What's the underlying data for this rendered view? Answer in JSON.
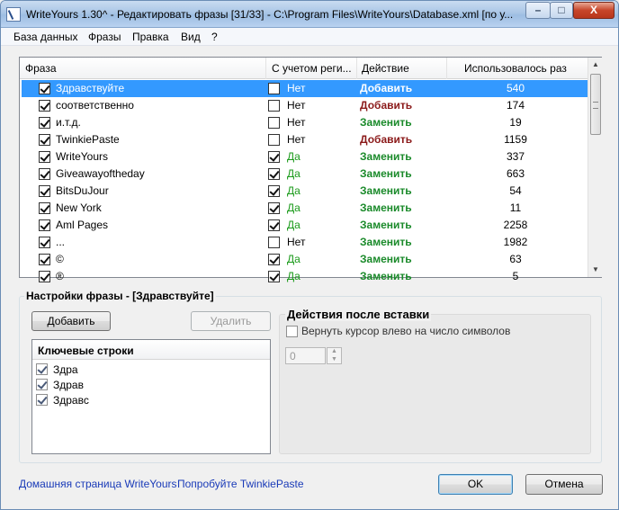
{
  "window": {
    "title": "WriteYours 1.30^ - Редактировать фразы [31/33] - C:\\Program Files\\WriteYours\\Database.xml [по у...",
    "minimize": "–",
    "maximize": "□",
    "close": "X"
  },
  "menu": [
    "База данных",
    "Фразы",
    "Правка",
    "Вид",
    "?"
  ],
  "table": {
    "columns": [
      "Фраза",
      "С учетом реги...",
      "Действие",
      "Использовалось раз"
    ],
    "rows": [
      {
        "phrase": "Здравствуйте",
        "enabled": true,
        "case": false,
        "case_label": "Нет",
        "action": "Добавить",
        "count": "540",
        "selected": true
      },
      {
        "phrase": "соответственно",
        "enabled": true,
        "case": false,
        "case_label": "Нет",
        "action": "Добавить",
        "count": "174"
      },
      {
        "phrase": "и.т.д.",
        "enabled": true,
        "case": false,
        "case_label": "Нет",
        "action": "Заменить",
        "count": "19"
      },
      {
        "phrase": "TwinkiePaste",
        "enabled": true,
        "case": false,
        "case_label": "Нет",
        "action": "Добавить",
        "count": "1159"
      },
      {
        "phrase": "WriteYours",
        "enabled": true,
        "case": true,
        "case_label": "Да",
        "action": "Заменить",
        "count": "337"
      },
      {
        "phrase": "Giveawayoftheday",
        "enabled": true,
        "case": true,
        "case_label": "Да",
        "action": "Заменить",
        "count": "663"
      },
      {
        "phrase": "BitsDuJour",
        "enabled": true,
        "case": true,
        "case_label": "Да",
        "action": "Заменить",
        "count": "54"
      },
      {
        "phrase": "New York",
        "enabled": true,
        "case": true,
        "case_label": "Да",
        "action": "Заменить",
        "count": "11"
      },
      {
        "phrase": "Aml Pages",
        "enabled": true,
        "case": true,
        "case_label": "Да",
        "action": "Заменить",
        "count": "2258"
      },
      {
        "phrase": "...",
        "enabled": true,
        "case": false,
        "case_label": "Нет",
        "action": "Заменить",
        "count": "1982"
      },
      {
        "phrase": "©",
        "enabled": true,
        "case": true,
        "case_label": "Да",
        "action": "Заменить",
        "count": "63"
      },
      {
        "phrase": "®",
        "enabled": true,
        "case": true,
        "case_label": "Да",
        "action": "Заменить",
        "count": "5"
      }
    ]
  },
  "settings": {
    "group_title": "Настройки фразы - [Здравствуйте]",
    "add_button": "Добавить",
    "delete_button": "Удалить",
    "key_strings_header": "Ключевые строки",
    "key_strings": [
      "Здра",
      "Здрав",
      "Здравс"
    ],
    "after_insert_title": "Действия после вставки",
    "return_cursor_label": "Вернуть курсор влево на число символов",
    "cursor_value": "0"
  },
  "footer": {
    "home_link": "Домашняя страница WriteYours",
    "try_link": "Попробуйте TwinkiePaste",
    "ok": "OK",
    "cancel": "Отмена"
  },
  "colors": {
    "selected_row": "#3399ff",
    "add_action": "#8b1a1a",
    "replace_action": "#1a8a2a",
    "yes_text": "#1a9a1a",
    "link": "#1a3bb8"
  }
}
